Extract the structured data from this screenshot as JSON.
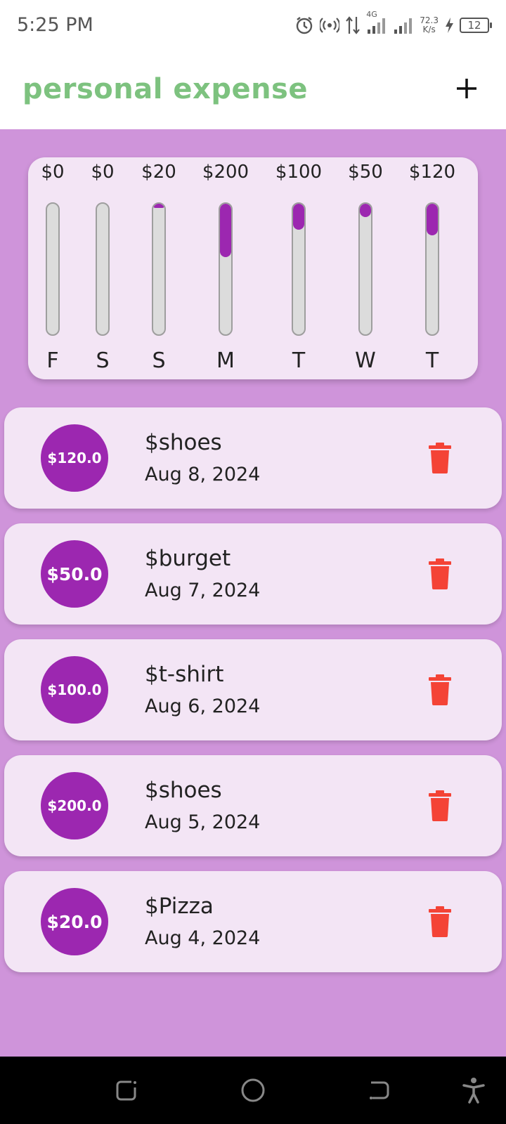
{
  "status": {
    "time": "5:25 PM",
    "network": "4G",
    "speed_value": "72.3",
    "speed_unit": "K/s",
    "battery": "12"
  },
  "app_bar": {
    "title": "personal expense",
    "add_icon": "plus-icon"
  },
  "chart_data": {
    "type": "bar",
    "categories": [
      "F",
      "S",
      "S",
      "M",
      "T",
      "W",
      "T"
    ],
    "values": [
      0,
      0,
      20,
      200,
      100,
      50,
      120
    ],
    "value_labels": [
      "$0",
      "$0",
      "$20",
      "$200",
      "$100",
      "$50",
      "$120"
    ],
    "fill_fraction": [
      0,
      0,
      0.034,
      0.41,
      0.2,
      0.1,
      0.24
    ],
    "title": "",
    "xlabel": "",
    "ylabel": ""
  },
  "transactions": [
    {
      "amount": "$120.0",
      "title": "$shoes",
      "date": "Aug 8, 2024"
    },
    {
      "amount": "$50.0",
      "title": "$burget",
      "date": "Aug 7, 2024"
    },
    {
      "amount": "$100.0",
      "title": "$t-shirt",
      "date": "Aug 6, 2024"
    },
    {
      "amount": "$200.0",
      "title": "$shoes",
      "date": "Aug 5, 2024"
    },
    {
      "amount": "$20.0",
      "title": "$Pizza",
      "date": "Aug 4, 2024"
    }
  ],
  "colors": {
    "title_green": "#7dc27f",
    "accent_purple": "#9c27b0",
    "background_purple": "#cf94da",
    "card_bg": "#f3e5f5",
    "delete_red": "#f44336"
  },
  "icons": {
    "delete": "trash-icon",
    "fab": "plus-icon",
    "nav": [
      "recent-apps-icon",
      "home-icon",
      "back-icon",
      "accessibility-icon"
    ]
  }
}
